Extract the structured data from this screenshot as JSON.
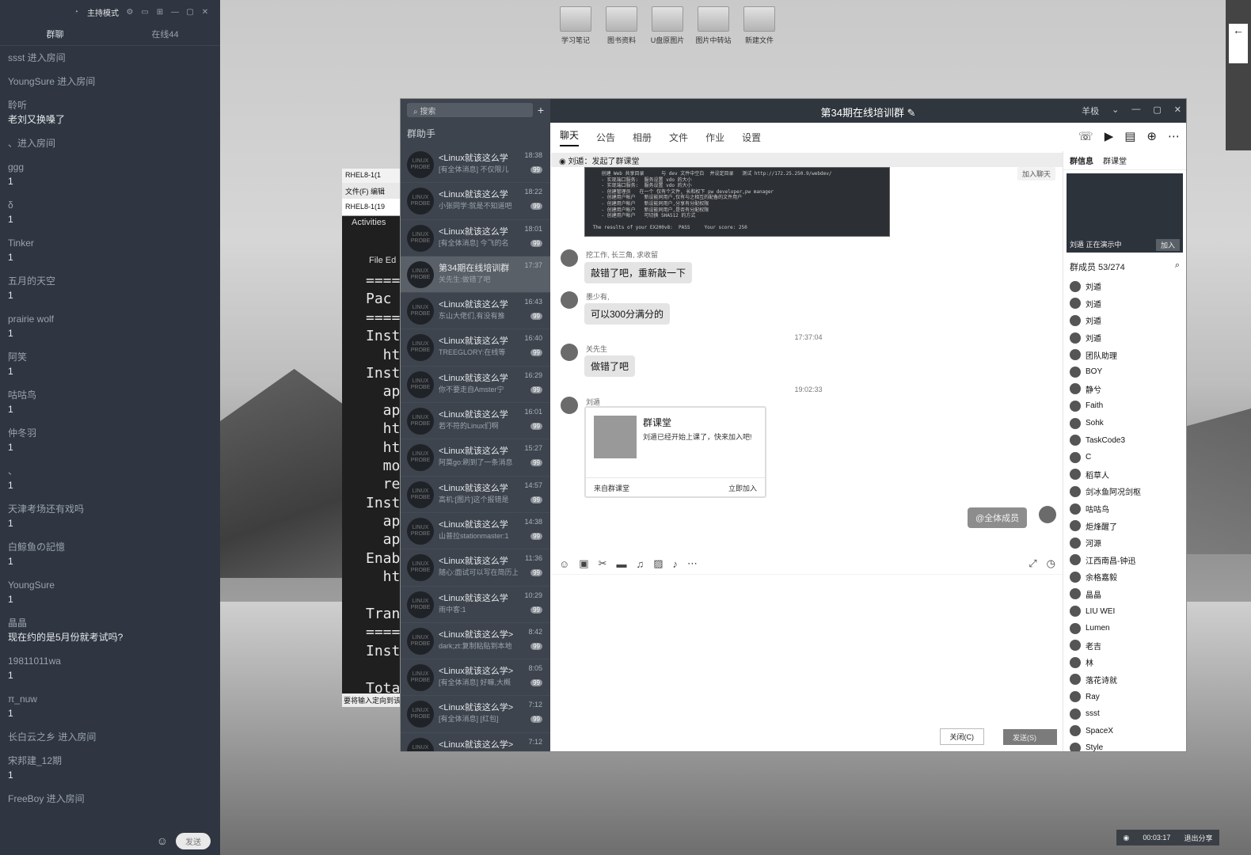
{
  "left_panel": {
    "mode_label": "主持模式",
    "tabs": [
      "群聊",
      "在线44"
    ],
    "messages": [
      {
        "name": "ssst 进入房间",
        "text": ""
      },
      {
        "name": "YoungSure 进入房间",
        "text": ""
      },
      {
        "name": "聆听",
        "text": "老刘又换嗓了"
      },
      {
        "name": "、进入房间",
        "text": ""
      },
      {
        "name": "ggg",
        "text": "1"
      },
      {
        "name": "δ",
        "text": "1"
      },
      {
        "name": "Tinker",
        "text": "1"
      },
      {
        "name": "五月的天空",
        "text": "1"
      },
      {
        "name": "prairie wolf",
        "text": "1"
      },
      {
        "name": "阿笑",
        "text": "1"
      },
      {
        "name": "咕咕鸟",
        "text": "1"
      },
      {
        "name": "仲冬羽",
        "text": "1"
      },
      {
        "name": "、",
        "text": "1"
      },
      {
        "name": "天津考场还有戏吗",
        "text": "1"
      },
      {
        "name": "白鲸鱼の記憶",
        "text": "1"
      },
      {
        "name": "YoungSure",
        "text": "1"
      },
      {
        "name": "晶晶",
        "text": "现在约的是5月份就考试吗?"
      },
      {
        "name": "19811011wa",
        "text": "1"
      },
      {
        "name": "π_nuw",
        "text": "1"
      },
      {
        "name": "长白云之乡 进入房间",
        "text": ""
      },
      {
        "name": "宋邦建_12期",
        "text": "1"
      },
      {
        "name": "FreeBoy 进入房间",
        "text": ""
      }
    ],
    "send_label": "发送"
  },
  "desktop_icons": [
    "学习笔记",
    "图书资料",
    "U盘原图片",
    "图片中转站",
    "新建文件"
  ],
  "terminal": {
    "title": "RHEL8-1(1",
    "menu": "文件(F)  编辑",
    "tab": "RHEL8-1(19",
    "activities": "Activities",
    "file_menu": "File  Ed",
    "lines": [
      "====",
      "Pac",
      "====",
      "Inst",
      "  htt",
      "Inst",
      "  apr",
      "  apr",
      "  htt",
      "  htt",
      "  mod",
      "  red",
      "Inst",
      "  apr",
      "  apr",
      "Enab",
      "  htt",
      "",
      "Tran",
      "====",
      "Inst",
      "",
      "Tota"
    ],
    "status": "要将输入定向到该"
  },
  "qq": {
    "title": "第34期在线培训群",
    "search": "搜索",
    "helper": "群助手",
    "window_label": "羊极",
    "conversations": [
      {
        "name": "<Linux就该这么学",
        "time": "18:38",
        "preview": "[有全体消息] 不仅限儿",
        "badge": "99"
      },
      {
        "name": "<Linux就该这么学",
        "time": "18:22",
        "preview": "小张同学:就是不知道吧",
        "badge": "99"
      },
      {
        "name": "<Linux就该这么学",
        "time": "18:01",
        "preview": "[有全体消息] 今飞的名",
        "badge": "99"
      },
      {
        "name": "第34期在线培训群",
        "time": "17:37",
        "preview": "关先生:做错了吧",
        "badge": ""
      },
      {
        "name": "<Linux就该这么学",
        "time": "16:43",
        "preview": "东山大佬们,有没有推",
        "badge": "99"
      },
      {
        "name": "<Linux就该这么学",
        "time": "16:40",
        "preview": "TREEGLORY:在线等",
        "badge": "99"
      },
      {
        "name": "<Linux就该这么学",
        "time": "16:29",
        "preview": "你不要走自Amster宁",
        "badge": "99"
      },
      {
        "name": "<Linux就该这么学",
        "time": "16:01",
        "preview": "若不符的Linux们啊",
        "badge": "99"
      },
      {
        "name": "<Linux就该这么学",
        "time": "15:27",
        "preview": "阿莫go:刷到了一条消息",
        "badge": "99"
      },
      {
        "name": "<Linux就该这么学",
        "time": "14:57",
        "preview": "高机:[图片]这个报错是",
        "badge": "99"
      },
      {
        "name": "<Linux就该这么学",
        "time": "14:38",
        "preview": "山普拉stationmaster:1",
        "badge": "99"
      },
      {
        "name": "<Linux就该这么学",
        "time": "11:36",
        "preview": "随心:面试可以写在简历上",
        "badge": "99"
      },
      {
        "name": "<Linux就该这么学",
        "time": "10:29",
        "preview": "雨中客:1",
        "badge": "99"
      },
      {
        "name": "<Linux就该这么学>",
        "time": "8:42",
        "preview": "dark;zt:复制粘贴到本地",
        "badge": "99"
      },
      {
        "name": "<Linux就该这么学>",
        "time": "8:05",
        "preview": "[有全体消息] 好嘛,大概",
        "badge": "99"
      },
      {
        "name": "<Linux就该这么学>",
        "time": "7:12",
        "preview": "[有全体消息] [红包]",
        "badge": "99"
      },
      {
        "name": "<Linux就该这么学>",
        "time": "7:12",
        "preview": "",
        "badge": ""
      }
    ],
    "tabs": [
      "聊天",
      "公告",
      "相册",
      "文件",
      "作业",
      "设置"
    ],
    "notice": "刘遁：发起了群课堂",
    "join_hint": "加入聊天",
    "screenshot_text": "    创建 Web 共享目录      与 dev 文件中空白  并设定目录   测试 http://172.25.250.9/webdev/\n    - 实现端口服务:  服务设置 vdo 的大小\n    - 实现端口服务:  服务设置 vdo 的大小\n    - 创建管理员   在一个 仅有个文件, 长和权下 pw developer,pw manager\n    - 创建用户帐户   新设能同用户,仅有与之相互的配备的文件用户\n    - 创建用户帐户   新设能同用户,分享有分配权限\n    - 创建用户帐户   新设能同用户,是否有分配权限\n    - 创建用户帐户   可切换 SHA512 的方式\n\n The results of your EX200v8:  PASS     Your score: 250",
    "messages": [
      {
        "sender": "挖工作, 长三角, 求收留",
        "text": "敲错了吧，重新敲一下"
      },
      {
        "sender": "墨少有,",
        "text": "可以300分满分的"
      },
      {
        "sender": "关先生",
        "text": "做错了吧"
      },
      {
        "sender": "刘遁",
        "text": ""
      }
    ],
    "times": [
      "17:37:04",
      "19:02:33"
    ],
    "card": {
      "title": "群课堂",
      "desc": "刘遁已经开始上课了，快来加入吧!",
      "source": "来自群课堂",
      "join": "立即加入"
    },
    "my_message": "@全体成员",
    "close_label": "关闭(C)",
    "send_label": "发送(S)",
    "side": {
      "tabs": [
        "群信息",
        "群课堂"
      ],
      "live_label": "刘遁 正在演示中",
      "live_join": "加入",
      "members_label": "群成员 53/274",
      "members": [
        "刘遁",
        "刘遁",
        "刘遁",
        "刘遁",
        "团队助理",
        "BOY",
        "静兮",
        "Faith",
        "Sohk",
        "TaskCode3",
        "C",
        "稻草人",
        "剑冰鱼阿况剑枢",
        "咕咕鸟",
        "炬烽醒了",
        "河源",
        "江西南昌-钟迅",
        "余格嘉毅",
        "晶晶",
        "LIU WEI",
        "Lumen",
        "老吉",
        "林",
        "落花诗就",
        "Ray",
        "ssst",
        "SpaceX",
        "Style"
      ]
    }
  },
  "recording": {
    "time": "00:03:17",
    "exit": "退出分享"
  }
}
